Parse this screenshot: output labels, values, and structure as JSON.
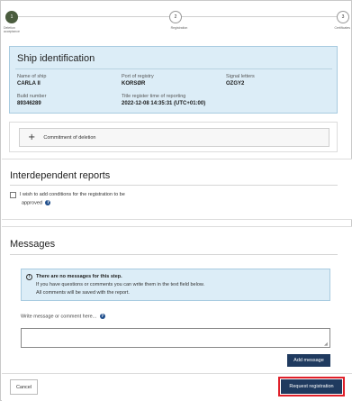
{
  "stepper": {
    "steps": [
      {
        "number": "1",
        "label": "Deletion acceptance",
        "state": "active"
      },
      {
        "number": "2",
        "label": "Registration",
        "state": "pending"
      },
      {
        "number": "3",
        "label": "Certificates",
        "state": "pending"
      }
    ]
  },
  "ship": {
    "title": "Ship identification",
    "name_label": "Name of ship",
    "name_value": "CARLA II",
    "port_label": "Port of registry",
    "port_value": "KORSØR",
    "signal_label": "Signal letters",
    "signal_value": "OZGY2",
    "build_label": "Build number",
    "build_value": "89346289",
    "title_time_label": "Title register time of reporting",
    "title_time_value": "2022-12-08 14:35:31 (UTC+01:00)"
  },
  "commitment": {
    "expand_symbol": "+",
    "label": "Commitment of deletion"
  },
  "interdependent": {
    "title": "Interdependent reports",
    "checkbox_line1": "I wish to add conditions for the registration to be",
    "checkbox_line2": "approved",
    "checked": false
  },
  "messages": {
    "title": "Messages",
    "info_title": "There are no messages for this step.",
    "info_line1": "If you have questions or comments you can write them in the text field below.",
    "info_line2": "All comments will be saved with the report.",
    "write_label": "Write message or comment here...",
    "textarea_value": "",
    "add_button": "Add message"
  },
  "footer": {
    "cancel": "Cancel",
    "request": "Request registration"
  },
  "colors": {
    "primary": "#1f3a5f",
    "info_bg": "#dcedf7",
    "highlight": "#e0202a",
    "active_step": "#4a5c3e"
  },
  "icons": {
    "help": "question-circle-icon",
    "info": "info-circle-icon",
    "expand": "plus-icon"
  }
}
